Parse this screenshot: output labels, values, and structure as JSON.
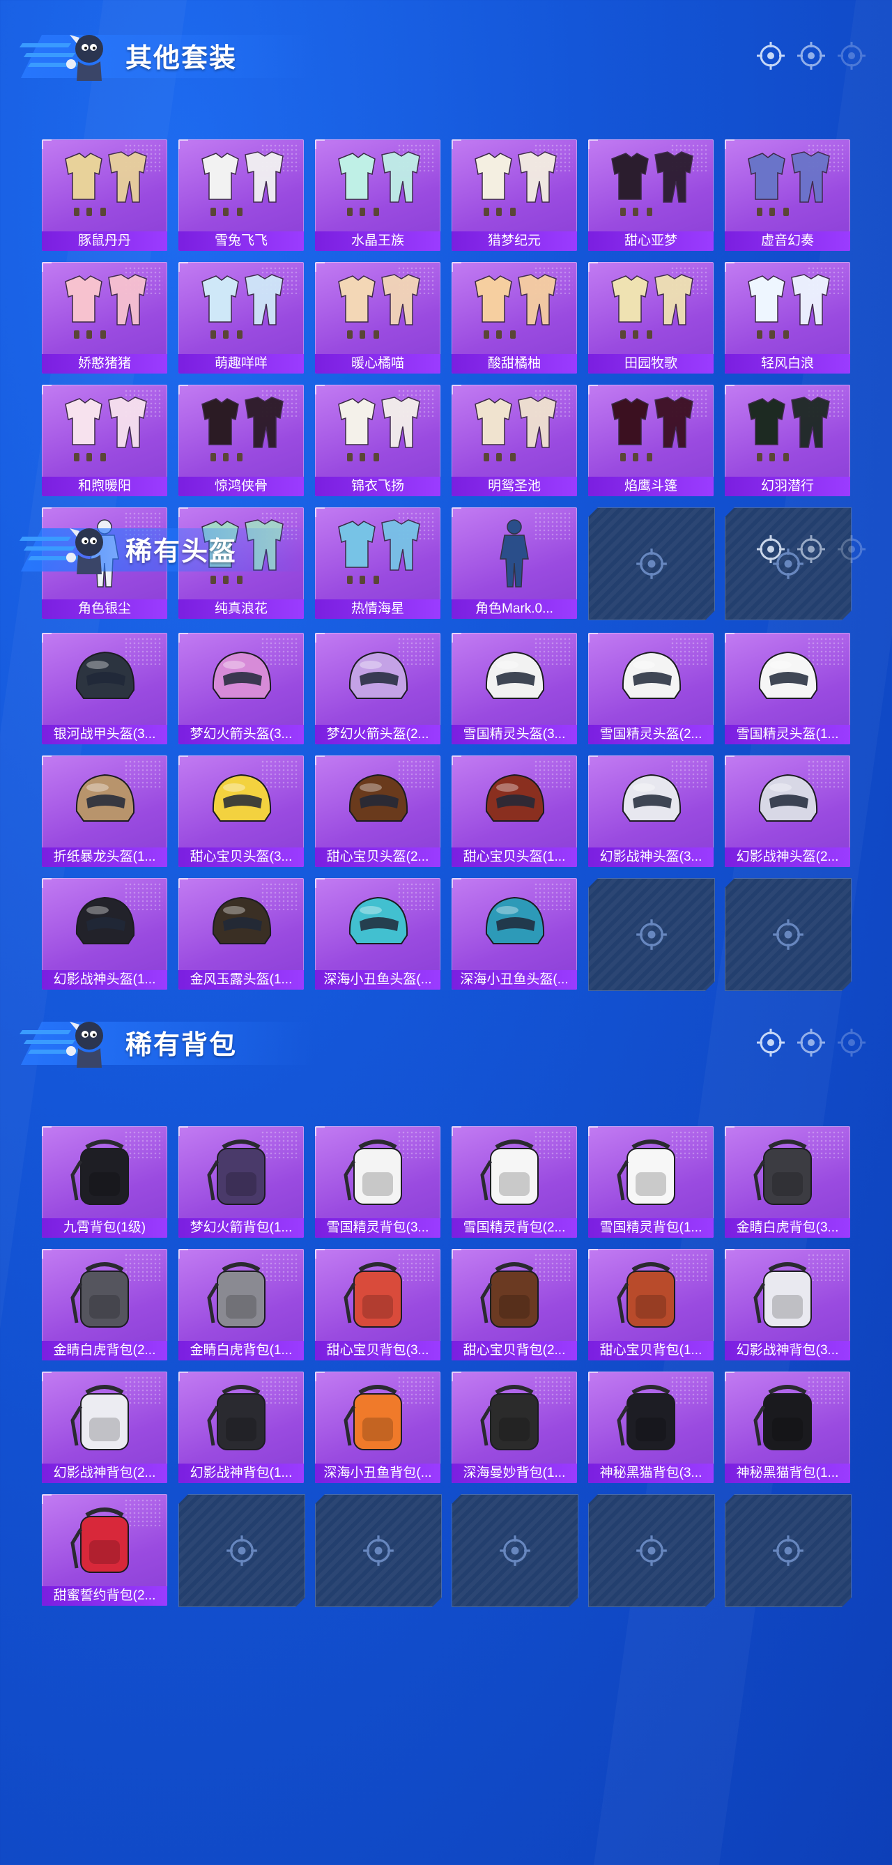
{
  "sections": [
    {
      "title": "其他套装",
      "items": [
        {
          "label": "豚鼠丹丹",
          "art": "outfit",
          "color": "#e8d29a"
        },
        {
          "label": "雪兔飞飞",
          "art": "outfit",
          "color": "#f2f2f2"
        },
        {
          "label": "水晶王族",
          "art": "outfit",
          "color": "#bff0e6"
        },
        {
          "label": "猎梦纪元",
          "art": "outfit",
          "color": "#f4efe1"
        },
        {
          "label": "甜心亚梦",
          "art": "outfit",
          "color": "#2b1d2e"
        },
        {
          "label": "虚音幻奏",
          "art": "outfit",
          "color": "#6a74c9"
        },
        {
          "label": "娇憨猪猪",
          "art": "outfit",
          "color": "#f7c2cf"
        },
        {
          "label": "萌趣咩咩",
          "art": "outfit",
          "color": "#cfe8f8"
        },
        {
          "label": "暖心橘喵",
          "art": "outfit",
          "color": "#f3d7b6"
        },
        {
          "label": "酸甜橘柚",
          "art": "outfit",
          "color": "#f6cfa0"
        },
        {
          "label": "田园牧歌",
          "art": "outfit",
          "color": "#efe2b2"
        },
        {
          "label": "轻风白浪",
          "art": "outfit",
          "color": "#eef6ff"
        },
        {
          "label": "和煦暖阳",
          "art": "outfit",
          "color": "#f7e2ee"
        },
        {
          "label": "惊鸿侠骨",
          "art": "outfit",
          "color": "#2b1b24"
        },
        {
          "label": "锦衣飞扬",
          "art": "outfit",
          "color": "#f4f1ea"
        },
        {
          "label": "明鸳圣池",
          "art": "outfit",
          "color": "#f0e3cf"
        },
        {
          "label": "焰鹰斗篷",
          "art": "outfit",
          "color": "#3b1020"
        },
        {
          "label": "幻羽潜行",
          "art": "outfit",
          "color": "#1d2a22"
        },
        {
          "label": "角色银尘",
          "art": "figure",
          "color": "#eef0f7"
        },
        {
          "label": "纯真浪花",
          "art": "outfit",
          "color": "#a4d9c9"
        },
        {
          "label": "热情海星",
          "art": "outfit",
          "color": "#77c3e6"
        },
        {
          "label": "角色Mark.0...",
          "art": "figure",
          "color": "#2a4e8a"
        }
      ],
      "empty_slots": 2
    },
    {
      "title": "稀有头盔",
      "items": [
        {
          "label": "银河战甲头盔(3...",
          "art": "helmet",
          "color": "#2c3440"
        },
        {
          "label": "梦幻火箭头盔(3...",
          "art": "helmet",
          "color": "#d78bd8"
        },
        {
          "label": "梦幻火箭头盔(2...",
          "art": "helmet",
          "color": "#c4a2e6"
        },
        {
          "label": "雪国精灵头盔(3...",
          "art": "helmet",
          "color": "#f2f2f2"
        },
        {
          "label": "雪国精灵头盔(2...",
          "art": "helmet",
          "color": "#f4f4f4"
        },
        {
          "label": "雪国精灵头盔(1...",
          "art": "helmet",
          "color": "#f6f6f6"
        },
        {
          "label": "折纸暴龙头盔(1...",
          "art": "helmet",
          "color": "#b8946c"
        },
        {
          "label": "甜心宝贝头盔(3...",
          "art": "helmet",
          "color": "#f3d23f"
        },
        {
          "label": "甜心宝贝头盔(2...",
          "art": "helmet",
          "color": "#6a3a1c"
        },
        {
          "label": "甜心宝贝头盔(1...",
          "art": "helmet",
          "color": "#8a2f1f"
        },
        {
          "label": "幻影战神头盔(3...",
          "art": "helmet",
          "color": "#e7e7ef"
        },
        {
          "label": "幻影战神头盔(2...",
          "art": "helmet",
          "color": "#d8d8e6"
        },
        {
          "label": "幻影战神头盔(1...",
          "art": "helmet",
          "color": "#22222a"
        },
        {
          "label": "金风玉露头盔(1...",
          "art": "helmet",
          "color": "#3a2f24"
        },
        {
          "label": "深海小丑鱼头盔(...",
          "art": "helmet",
          "color": "#42c0d0"
        },
        {
          "label": "深海小丑鱼头盔(...",
          "art": "helmet",
          "color": "#2d9ab8"
        }
      ],
      "empty_slots": 2
    },
    {
      "title": "稀有背包",
      "items": [
        {
          "label": "九霄背包(1级)",
          "art": "backpack",
          "color": "#1e1e24"
        },
        {
          "label": "梦幻火箭背包(1...",
          "art": "backpack",
          "color": "#4a3a6a"
        },
        {
          "label": "雪国精灵背包(3...",
          "art": "backpack",
          "color": "#f4f4f4"
        },
        {
          "label": "雪国精灵背包(2...",
          "art": "backpack",
          "color": "#f6f6f6"
        },
        {
          "label": "雪国精灵背包(1...",
          "art": "backpack",
          "color": "#f7f7f7"
        },
        {
          "label": "金睛白虎背包(3...",
          "art": "backpack",
          "color": "#3c3c42"
        },
        {
          "label": "金睛白虎背包(2...",
          "art": "backpack",
          "color": "#55555e"
        },
        {
          "label": "金睛白虎背包(1...",
          "art": "backpack",
          "color": "#8a8a92"
        },
        {
          "label": "甜心宝贝背包(3...",
          "art": "backpack",
          "color": "#d94b3b"
        },
        {
          "label": "甜心宝贝背包(2...",
          "art": "backpack",
          "color": "#6b3a22"
        },
        {
          "label": "甜心宝贝背包(1...",
          "art": "backpack",
          "color": "#b94b2b"
        },
        {
          "label": "幻影战神背包(3...",
          "art": "backpack",
          "color": "#e9e9f0"
        },
        {
          "label": "幻影战神背包(2...",
          "art": "backpack",
          "color": "#ececf2"
        },
        {
          "label": "幻影战神背包(1...",
          "art": "backpack",
          "color": "#2a2a30"
        },
        {
          "label": "深海小丑鱼背包(...",
          "art": "backpack",
          "color": "#f07a2a"
        },
        {
          "label": "深海曼妙背包(1...",
          "art": "backpack",
          "color": "#2b2b2b"
        },
        {
          "label": "神秘黑猫背包(3...",
          "art": "backpack",
          "color": "#1d1d24"
        },
        {
          "label": "神秘黑猫背包(1...",
          "art": "backpack",
          "color": "#1a1a1e"
        },
        {
          "label": "甜蜜誓约背包(2...",
          "art": "backpack",
          "color": "#d8283a"
        }
      ],
      "empty_slots": 5
    }
  ]
}
